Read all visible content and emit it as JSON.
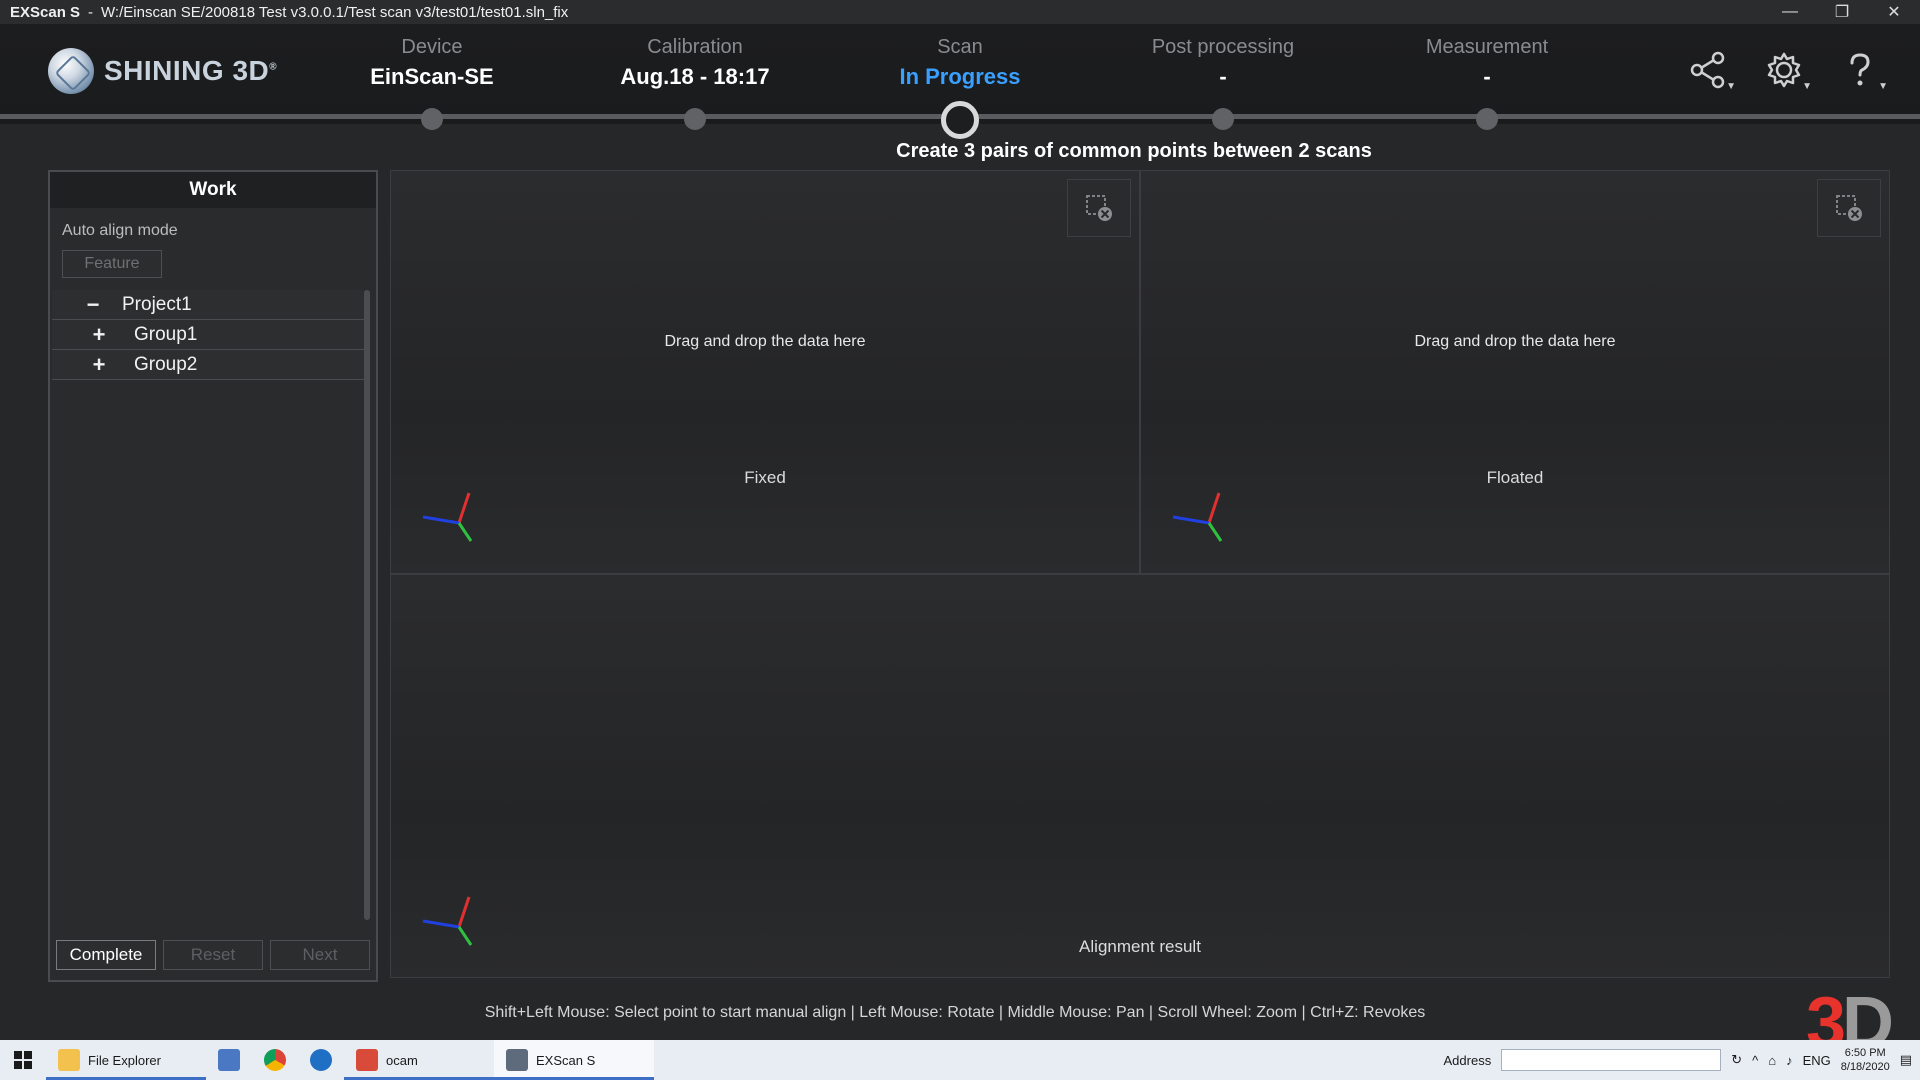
{
  "window": {
    "app_name": "EXScan S",
    "separator": "-",
    "path": "W:/Einscan SE/200818 Test v3.0.0.1/Test scan v3/test01/test01.sln_fix",
    "controls": {
      "minimize": "—",
      "restore": "❐",
      "close": "✕"
    }
  },
  "brand": {
    "name": "SHINING 3D",
    "reg": "®"
  },
  "steps": [
    {
      "label": "Device",
      "value": "EinScan-SE"
    },
    {
      "label": "Calibration",
      "value": "Aug.18 - 18:17"
    },
    {
      "label": "Scan",
      "value": "In Progress"
    },
    {
      "label": "Post processing",
      "value": "-"
    },
    {
      "label": "Measurement",
      "value": "-"
    }
  ],
  "header_icons": [
    "share-icon",
    "gear-icon",
    "help-icon"
  ],
  "instruction": "Create 3 pairs of common points between 2 scans",
  "work_panel": {
    "title": "Work",
    "align_mode_label": "Auto align mode",
    "feature_button": "Feature",
    "tree": [
      {
        "sign": "−",
        "label": "Project1"
      },
      {
        "sign": "+",
        "label": "Group1"
      },
      {
        "sign": "+",
        "label": "Group2"
      }
    ],
    "buttons": {
      "complete": "Complete",
      "reset": "Reset",
      "next": "Next"
    }
  },
  "viewports": {
    "drop_text": "Drag and drop the data here",
    "fixed_caption": "Fixed",
    "floated_caption": "Floated",
    "result_caption": "Alignment result"
  },
  "hint": "Shift+Left Mouse: Select point to start manual align | Left Mouse: Rotate | Middle Mouse: Pan | Scroll Wheel: Zoom | Ctrl+Z: Revokes",
  "watermark": "3D",
  "taskbar": {
    "items": [
      "File Explorer",
      "ocam",
      "EXScan S"
    ],
    "address_label": "Address",
    "language": "ENG",
    "time": "6:50 PM",
    "date": "8/18/2020"
  },
  "colors": {
    "accent": "#3aa0ff",
    "background": "#262729",
    "watermark_red": "#e8322c"
  }
}
